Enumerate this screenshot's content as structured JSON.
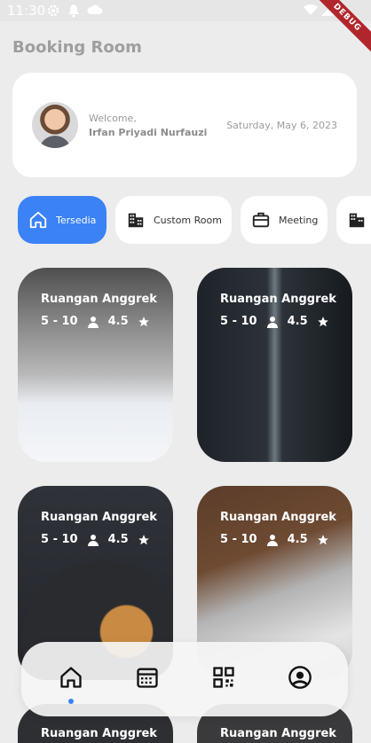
{
  "status_bar": {
    "time": "11:30",
    "debug_banner": "DEBUG"
  },
  "header": {
    "title": "Booking Room"
  },
  "profile": {
    "welcome": "Welcome,",
    "name": "Irfan Priyadi Nurfauzi",
    "date": "Saturday, May 6, 2023"
  },
  "categories": [
    {
      "label": "Tersedia",
      "icon": "home-icon",
      "active": true
    },
    {
      "label": "Custom Room",
      "icon": "building-icon",
      "active": false
    },
    {
      "label": "Meeting",
      "icon": "briefcase-icon",
      "active": false
    },
    {
      "label": "",
      "icon": "building-icon",
      "active": false
    }
  ],
  "rooms": [
    {
      "title": "Ruangan Anggrek",
      "capacity": "5 - 10",
      "rating": "4.5",
      "image": "snowy-forest"
    },
    {
      "title": "Ruangan Anggrek",
      "capacity": "5 - 10",
      "rating": "4.5",
      "image": "tower"
    },
    {
      "title": "Ruangan Anggrek",
      "capacity": "5 - 10",
      "rating": "4.5",
      "image": "cookies-food"
    },
    {
      "title": "Ruangan Anggrek",
      "capacity": "5 - 10",
      "rating": "4.5",
      "image": "keyboard-desk"
    },
    {
      "title": "Ruangan Anggrek",
      "capacity": "",
      "rating": "",
      "image": "dark"
    },
    {
      "title": "Ruangan Anggrek",
      "capacity": "",
      "rating": "",
      "image": "dark"
    }
  ],
  "bottom_nav": {
    "items": [
      "home-icon",
      "calendar-icon",
      "qr-code-icon",
      "account-icon"
    ],
    "active_index": 0
  },
  "colors": {
    "accent": "#3b82f6",
    "background": "#ececec",
    "card": "#ffffff"
  }
}
